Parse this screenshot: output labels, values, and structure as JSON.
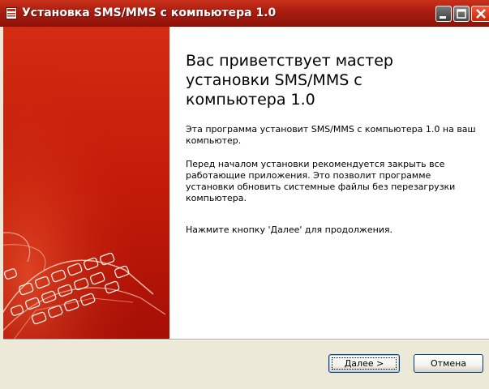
{
  "window": {
    "title": "Установка SMS/MMS с компьютера 1.0",
    "icon": "installer-icon",
    "controls": [
      "minimize-icon",
      "maximize-icon",
      "close-icon"
    ]
  },
  "main": {
    "heading_line1": "Вас приветствует мастер",
    "heading_line2": "установки SMS/MMS с",
    "heading_line3": "компьютера 1.0",
    "paragraph1": "Эта программа установит SMS/MMS с компьютера 1.0 на ваш компьютер.",
    "paragraph2": "Перед началом установки рекомендуется закрыть все работающие приложения. Это позволит программе установки обновить системные файлы без перезагрузки компьютера.",
    "paragraph3": "Нажмите кнопку 'Далее' для продолжения."
  },
  "buttons": {
    "next_accel": "Д",
    "next_rest": "алее >",
    "cancel": "Отмена"
  },
  "colors": {
    "titlebar": "#a81c10",
    "banner": "#c11a08",
    "dialog_face": "#ece9d8"
  }
}
